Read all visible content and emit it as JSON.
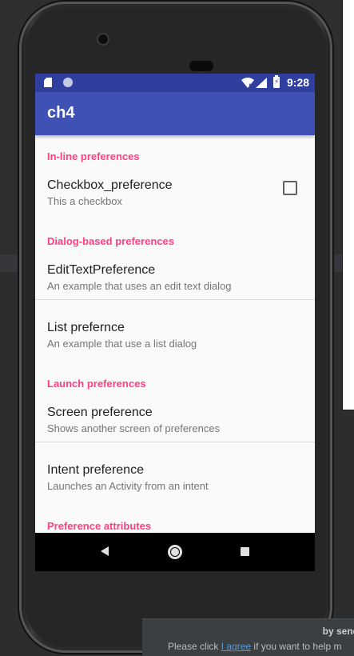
{
  "status_bar": {
    "time": "9:28",
    "icons": [
      "sd-card-icon",
      "notification-dot-icon",
      "wifi-icon",
      "signal-icon",
      "battery-icon"
    ],
    "battery_glyph": "⚡"
  },
  "app_bar": {
    "title": "ch4",
    "color": "#3f51b5",
    "status_color": "#303f9f"
  },
  "preferences": {
    "categories": [
      {
        "title": "In-line preferences"
      },
      {
        "title": "Dialog-based preferences"
      },
      {
        "title": "Launch preferences"
      },
      {
        "title": "Preference attributes"
      }
    ],
    "items": [
      {
        "title": "Checkbox_preference",
        "summary": "This a checkbox",
        "checked": false
      },
      {
        "title": "EditTextPreference",
        "summary": "An example that uses an edit text dialog"
      },
      {
        "title": "List prefernce",
        "summary": "An example that use a list dialog"
      },
      {
        "title": "Screen preference",
        "summary": "Shows another screen of preferences"
      },
      {
        "title": "Intent preference",
        "summary": "Launches an Activity from an intent"
      }
    ],
    "accent_color": "#ff4081"
  },
  "nav_bar": {
    "icons": [
      "back-icon",
      "home-icon",
      "recents-icon"
    ]
  },
  "ide_notice": {
    "line1": "by send",
    "line2_prefix": "Please click ",
    "link": "I agree",
    "line2_suffix": " if you want to help m"
  }
}
